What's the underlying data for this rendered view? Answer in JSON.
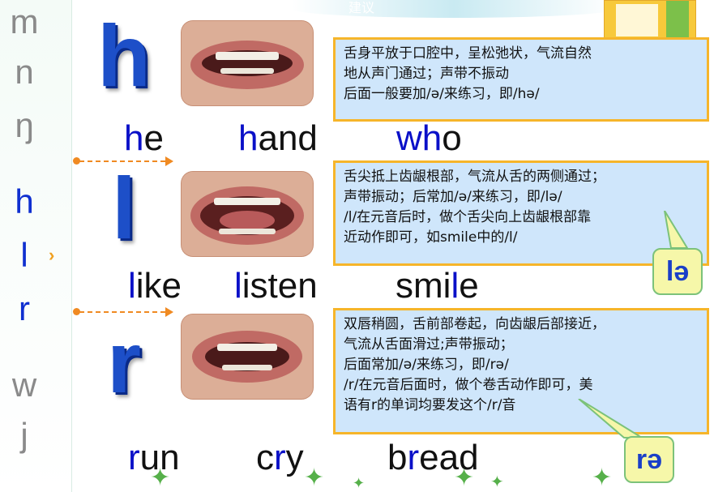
{
  "sidebar": {
    "letters": [
      {
        "text": "m",
        "state": "dim"
      },
      {
        "text": "n",
        "state": "dim"
      },
      {
        "text": "ŋ",
        "state": "dim"
      },
      {
        "text": "h",
        "state": "active"
      },
      {
        "text": "l",
        "state": "active"
      },
      {
        "text": "r",
        "state": "active"
      },
      {
        "text": "w",
        "state": "dim"
      },
      {
        "text": "j",
        "state": "dim"
      }
    ],
    "pointer_glyph": "›"
  },
  "top_banner": {
    "watermark": "建议"
  },
  "sections": [
    {
      "letter": "h",
      "description": [
        "舌身平放于口腔中，呈松弛状，气流自然",
        "地从声门通过；声带不振动",
        "后面一般要加/ə/来练习，即/hə/"
      ],
      "words": [
        {
          "highlight": "h",
          "rest": "e"
        },
        {
          "highlight": "h",
          "rest": "and"
        },
        {
          "highlight": "wh",
          "rest": "o"
        }
      ]
    },
    {
      "letter": "l",
      "description": [
        "舌尖抵上齿龈根部，气流从舌的两侧通过；",
        "声带振动；后常加/ə/来练习，即/lə/",
        "/l/在元音后时，做个舌尖向上齿龈根部靠",
        "近动作即可，如smile中的/l/"
      ],
      "words": [
        {
          "highlight": "l",
          "rest": "ike"
        },
        {
          "highlight": "l",
          "rest": "isten"
        },
        {
          "pre": "smi",
          "highlight": "l",
          "rest": "e"
        }
      ],
      "callout": "lə"
    },
    {
      "letter": "r",
      "description": [
        "双唇稍圆，舌前部卷起，向齿龈后部接近，",
        "气流从舌面滑过;声带振动；",
        "后面常加/ə/来练习，即/rə/",
        "/r/在元音后面时，做个卷舌动作即可，美",
        "语有r的单词均要发这个/r/音"
      ],
      "words": [
        {
          "highlight": "r",
          "rest": "un"
        },
        {
          "pre": "c",
          "highlight": "r",
          "rest": "y"
        },
        {
          "pre": "b",
          "highlight": "r",
          "rest": "ead"
        }
      ],
      "callout": "rə"
    }
  ],
  "colors": {
    "accent": "#0a10c8",
    "letter": "#1d4fc8",
    "box_fill": "#cfe6fb",
    "box_border": "#f6b52a",
    "arrow": "#f08a22"
  }
}
